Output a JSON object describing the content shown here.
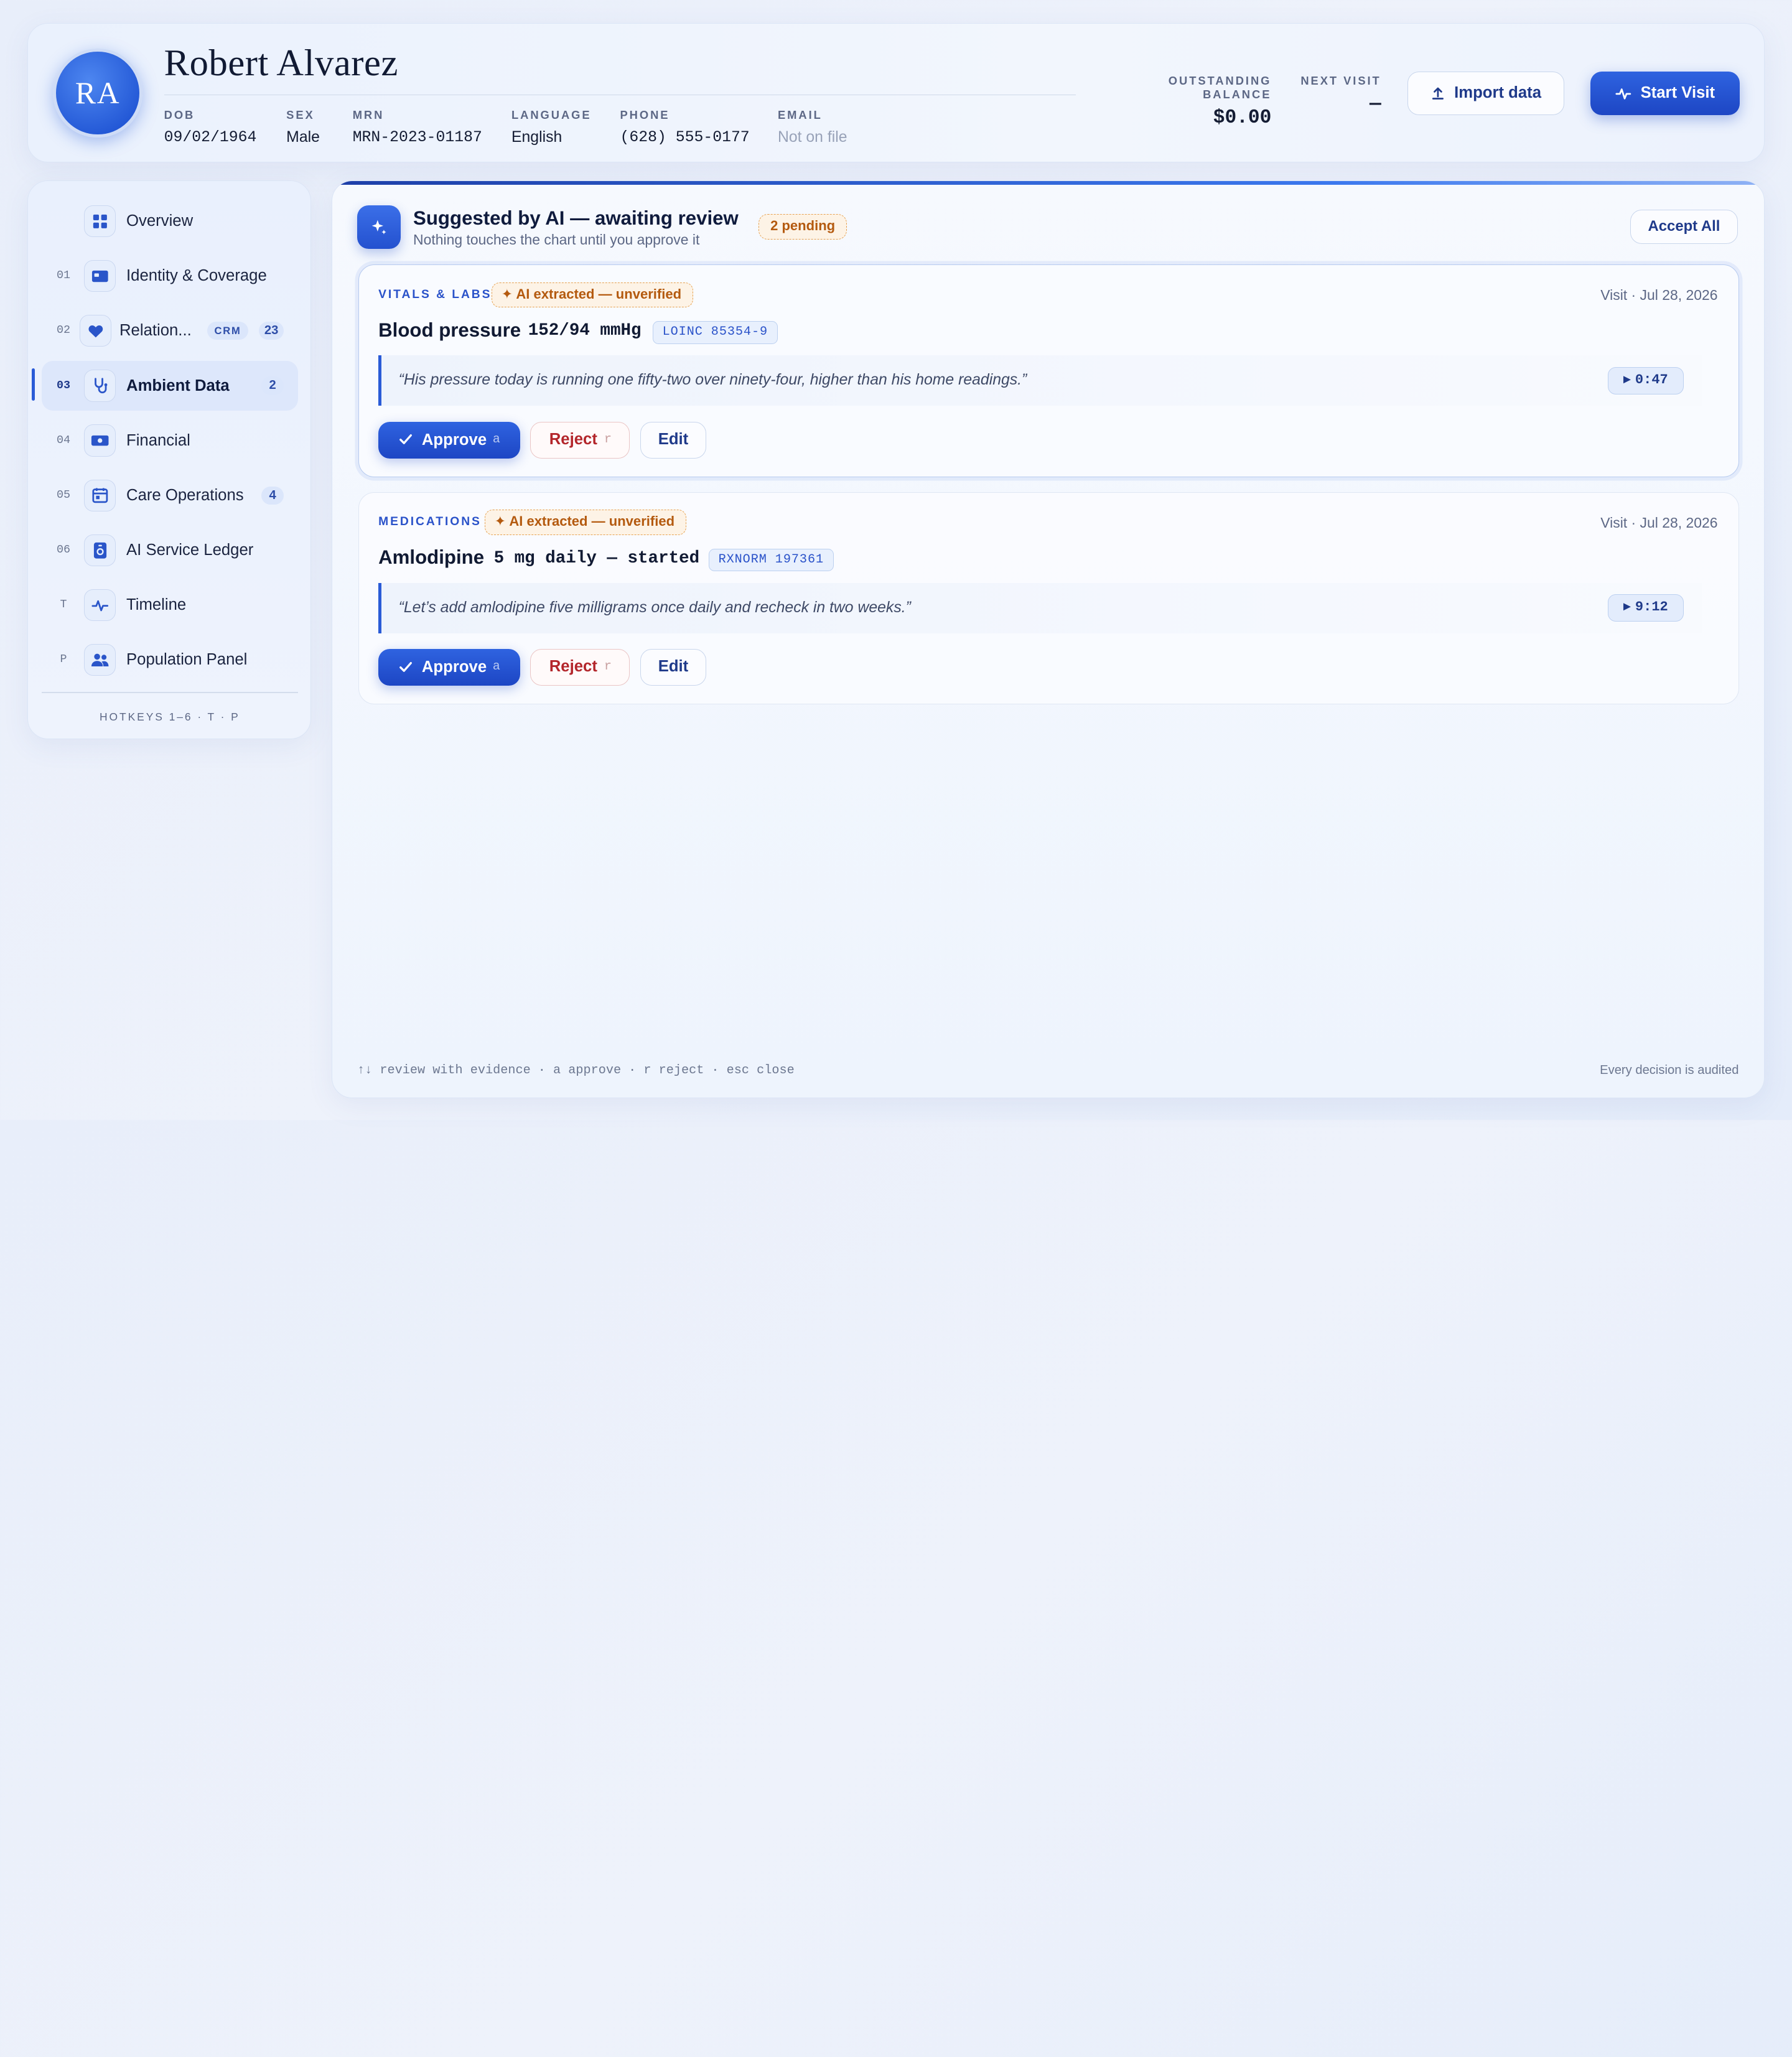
{
  "patient": {
    "initials": "RA",
    "name": "Robert Alvarez",
    "fields": [
      {
        "label": "DOB",
        "value": "09/02/1964"
      },
      {
        "label": "SEX",
        "value": "Male"
      },
      {
        "label": "MRN",
        "value": "MRN-2023-01187"
      },
      {
        "label": "LANGUAGE",
        "value": "English"
      },
      {
        "label": "PHONE",
        "value": "(628) 555-0177"
      },
      {
        "label": "EMAIL",
        "value": "Not on file"
      }
    ]
  },
  "stats": {
    "balance_label": "OUTSTANDING BALANCE",
    "balance_value": "$0.00",
    "next_visit_label": "NEXT VISIT",
    "next_visit_value": "—"
  },
  "actions": {
    "import_label": "Import data",
    "start_visit_label": "Start Visit"
  },
  "sidebar": {
    "items": [
      {
        "num": "",
        "label": "Overview",
        "icon": "grid-icon"
      },
      {
        "num": "01",
        "label": "Identity & Coverage",
        "icon": "id-card-icon"
      },
      {
        "num": "02",
        "label": "Relation...",
        "icon": "heart-icon",
        "tag": "CRM",
        "count": "23"
      },
      {
        "num": "03",
        "label": "Ambient Data",
        "icon": "stethoscope-icon",
        "count": "2",
        "active": true
      },
      {
        "num": "04",
        "label": "Financial",
        "icon": "banknote-icon"
      },
      {
        "num": "05",
        "label": "Care Operations",
        "icon": "calendar-icon",
        "count": "4"
      },
      {
        "num": "06",
        "label": "AI Service Ledger",
        "icon": "ledger-icon"
      },
      {
        "num": "T",
        "label": "Timeline",
        "icon": "pulse-icon"
      },
      {
        "num": "P",
        "label": "Population Panel",
        "icon": "people-icon"
      }
    ],
    "hotkeys": "HOTKEYS 1–6 · T · P"
  },
  "review": {
    "title": "Suggested by AI — awaiting review",
    "subtitle": "Nothing touches the chart until you approve it",
    "pending_badge": "2 pending",
    "accept_all_label": "Accept All",
    "ai_badge": "AI extracted — unverified",
    "approve_label": "Approve",
    "approve_key": "a",
    "reject_label": "Reject",
    "reject_key": "r",
    "edit_label": "Edit",
    "cards": [
      {
        "category": "VITALS & LABS",
        "visit_date": "Visit · Jul 28, 2026",
        "name": "Blood pressure",
        "value": "152/94 mmHg",
        "code": "LOINC 85354-9",
        "quote": "“His pressure today is running one fifty-two over ninety-four, higher than his home readings.”",
        "timestamp": "0:47"
      },
      {
        "category": "MEDICATIONS",
        "visit_date": "Visit · Jul 28, 2026",
        "name": "Amlodipine",
        "value": "5 mg daily — started",
        "code": "RXNORM 197361",
        "quote": "“Let’s add amlodipine five milligrams once daily and recheck in two weeks.”",
        "timestamp": "9:12"
      }
    ],
    "footer_hint": "↑↓ review with evidence · a approve · r reject · esc close",
    "footer_audit": "Every decision is audited"
  },
  "colors": {
    "accent": "#2a5bd7",
    "warning": "#b45a0f",
    "danger": "#b3262b"
  }
}
